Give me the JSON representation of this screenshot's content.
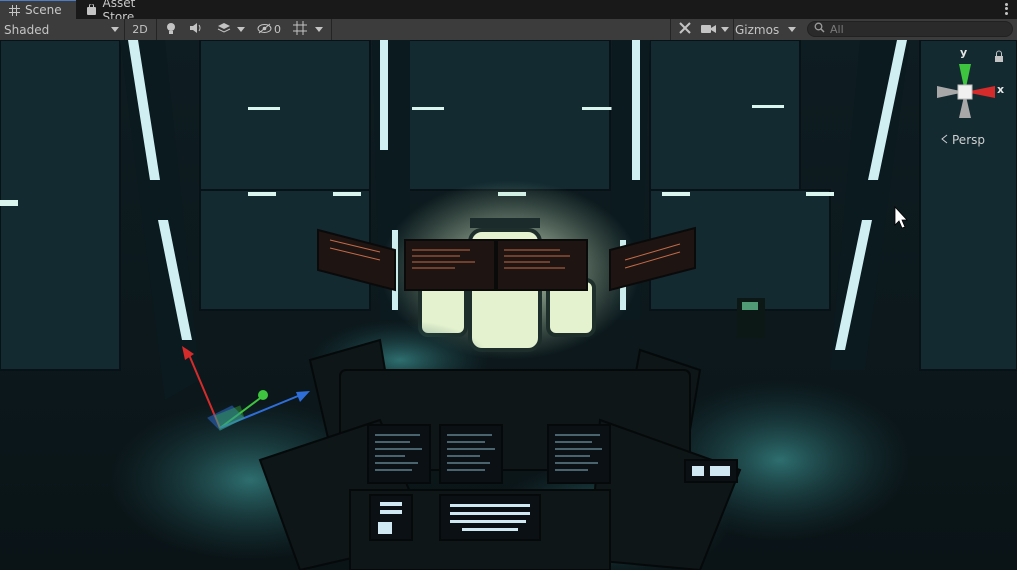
{
  "tabs": [
    {
      "label": "Scene",
      "icon": "grid-icon"
    },
    {
      "label": "Asset Store",
      "icon": "shopping-bag-icon"
    }
  ],
  "toolbar": {
    "shading_mode": "Shaded",
    "mode_2d_label": "2D",
    "hidden_count": "0",
    "gizmos_label": "Gizmos",
    "search_placeholder": "All"
  },
  "viewport": {
    "projection_label": "Persp",
    "axis_labels": {
      "y": "y",
      "x": "x"
    },
    "colors": {
      "x_axis": "#d62b2b",
      "y_axis": "#3fc43f",
      "z_axis": "#2f6ed8",
      "accent": "#4c7bc8"
    }
  }
}
